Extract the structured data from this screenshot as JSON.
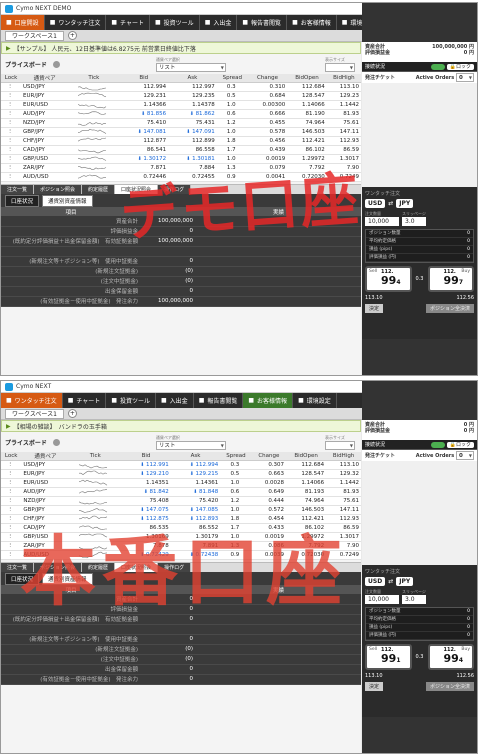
{
  "windows": [
    {
      "title": "Cymo NEXT DEMO",
      "menu": [
        {
          "label": "口座開設",
          "icon": "account-icon",
          "active": true
        },
        {
          "label": "ワンタッチ注文",
          "icon": "pointer-icon"
        },
        {
          "label": "チャート",
          "icon": "chart-icon"
        },
        {
          "label": "投資ツール",
          "icon": "tools-icon"
        },
        {
          "label": "入出金",
          "icon": "money-icon"
        },
        {
          "label": "報告書閲覧",
          "icon": "report-icon"
        },
        {
          "label": "お客様情報",
          "icon": "person-icon"
        },
        {
          "label": "環境設定",
          "icon": "settings-icon"
        }
      ],
      "help_label": "?",
      "logout_label": "ログアウト画面へ",
      "workspace_tab": "ワークスペース1",
      "news": "【サンプル】 人民元、12日基準値は6.8275元 前営業日終値比下落",
      "priceboard": {
        "title": "プライスボード",
        "select_label": "通貨ペア選択",
        "select_value": "リスト",
        "size_label": "表示サイズ"
      },
      "columns": [
        "Lock",
        "通貨ペア",
        "Tick",
        "Bid",
        "Ask",
        "Spread",
        "Change",
        "BidOpen",
        "BidHigh"
      ],
      "rows": [
        {
          "pair": "USD/JPY",
          "bid": "112.994",
          "ask": "112.997",
          "spread": "0.3",
          "change": "0.310",
          "open": "112.684",
          "high": "113.10"
        },
        {
          "pair": "EUR/JPY",
          "bid": "129.231",
          "ask": "129.235",
          "spread": "0.5",
          "change": "0.684",
          "open": "128.547",
          "high": "129.23"
        },
        {
          "pair": "EUR/USD",
          "bid": "1.14366",
          "ask": "1.14378",
          "spread": "1.0",
          "change": "0.00300",
          "open": "1.14066",
          "high": "1.1442"
        },
        {
          "pair": "AUD/JPY",
          "bid": "81.856",
          "ask": "81.862",
          "spread": "0.6",
          "change": "0.666",
          "open": "81.190",
          "high": "81.93"
        },
        {
          "pair": "NZD/JPY",
          "bid": "75.410",
          "ask": "75.431",
          "spread": "1.2",
          "change": "0.455",
          "open": "74.964",
          "high": "75.61"
        },
        {
          "pair": "GBP/JPY",
          "bid": "147.081",
          "ask": "147.091",
          "spread": "1.0",
          "change": "0.578",
          "open": "146.503",
          "high": "147.11"
        },
        {
          "pair": "CHF/JPY",
          "bid": "112.877",
          "ask": "112.899",
          "spread": "1.8",
          "change": "0.456",
          "open": "112.421",
          "high": "112.93"
        },
        {
          "pair": "CAD/JPY",
          "bid": "86.541",
          "ask": "86.558",
          "spread": "1.7",
          "change": "0.439",
          "open": "86.102",
          "high": "86.59"
        },
        {
          "pair": "GBP/USD",
          "bid": "1.30172",
          "ask": "1.30181",
          "spread": "1.0",
          "change": "0.0019",
          "open": "1.29972",
          "high": "1.3017"
        },
        {
          "pair": "ZAR/JPY",
          "bid": "7.871",
          "ask": "7.884",
          "spread": "1.3",
          "change": "0.079",
          "open": "7.792",
          "high": "7.90"
        },
        {
          "pair": "AUD/USD",
          "bid": "0.72446",
          "ask": "0.72455",
          "spread": "0.9",
          "change": "0.0041",
          "open": "0.72030",
          "high": "0.7249"
        }
      ],
      "tabs": [
        "注文一覧",
        "ポジション照会",
        "約定履歴",
        "口座状況照会",
        "操作ログ"
      ],
      "subtabs": [
        "口座状況",
        "通貨別資産情報"
      ],
      "acct_head": [
        "項目",
        "",
        "",
        "実績"
      ],
      "acct_rows": [
        {
          "label": "資産合計",
          "value": "100,000,000"
        },
        {
          "label": "評価損益金",
          "value": "0"
        },
        {
          "label": "(既約定分評価損益＋出金保留金額)　有効証拠金額",
          "value": "100,000,000"
        },
        {
          "label": "",
          "value": ""
        },
        {
          "label": "(新規注文等＋ポジション等)　使用中証拠金",
          "value": "0"
        },
        {
          "label": "(新規注文証拠金)",
          "value": "(0)"
        },
        {
          "label": "(注文中証拠金)",
          "value": "(0)"
        },
        {
          "label": "出金保留金額",
          "value": "0"
        },
        {
          "label": "(有効証拠金－使用中証拠金)　発注余力",
          "value": "100,000,000"
        }
      ],
      "right": {
        "asset_label": "資産合計",
        "asset_value": "100,000,000 円",
        "pl_label": "評価損益金",
        "pl_value": "0 円",
        "connection_label": "接続状況",
        "lock_label": "ロック",
        "order_label": "発注チケット",
        "active_orders": "Active Orders",
        "active_count": "0",
        "ticket_title": "ワンタッチ注文",
        "pair_base": "USD",
        "pair_quote": "JPY",
        "qty_label": "注文数量",
        "qty_value": "10,000",
        "slip_label": "スリッページ",
        "slip_value": "3.0",
        "pos_rows": [
          {
            "label": "ポジション数量",
            "value": "0"
          },
          {
            "label": "平均約定価格",
            "value": "0"
          },
          {
            "label": "損益 (pips)",
            "value": "0"
          },
          {
            "label": "評価損益 (円)",
            "value": "0"
          }
        ],
        "sell_label": "Sell",
        "buy_label": "Buy",
        "sell_pre": "112.",
        "sell_big": "99",
        "sell_small": "4",
        "buy_pre": "112.",
        "buy_big": "99",
        "buy_small": "7",
        "spread": "0.3",
        "low": "113.10",
        "high": "112.56",
        "btn1": "決定",
        "btn2": "ポジション全決済"
      },
      "overlay": "デモ口座"
    },
    {
      "title": "Cymo NEXT",
      "menu": [
        {
          "label": "ワンタッチ注文",
          "icon": "pointer-icon",
          "active": true
        },
        {
          "label": "チャート",
          "icon": "chart-icon"
        },
        {
          "label": "投資ツール",
          "icon": "tools-icon"
        },
        {
          "label": "入出金",
          "icon": "money-icon"
        },
        {
          "label": "報告書閲覧",
          "icon": "report-icon"
        },
        {
          "label": "お客様情報",
          "icon": "person-icon",
          "green": true
        },
        {
          "label": "環境設定",
          "icon": "settings-icon"
        }
      ],
      "help_label": "?",
      "logout_label": "ログアウト画面へ",
      "workspace_tab": "ワークスペース1",
      "news": "【相場の雑談】　バンドラの玉手箱",
      "priceboard": {
        "title": "プライスボード",
        "select_label": "通貨ペア選択",
        "select_value": "リスト",
        "size_label": "表示サイズ"
      },
      "columns": [
        "Lock",
        "通貨ペア",
        "Tick",
        "Bid",
        "Ask",
        "Spread",
        "Change",
        "BidOpen",
        "BidHigh"
      ],
      "rows": [
        {
          "pair": "USD/JPY",
          "bid": "112.991",
          "ask": "112.994",
          "spread": "0.3",
          "change": "0.307",
          "open": "112.684",
          "high": "113.10"
        },
        {
          "pair": "EUR/JPY",
          "bid": "129.210",
          "ask": "129.215",
          "spread": "0.5",
          "change": "0.663",
          "open": "128.547",
          "high": "129.32"
        },
        {
          "pair": "EUR/USD",
          "bid": "1.14351",
          "ask": "1.14361",
          "spread": "1.0",
          "change": "0.0028",
          "open": "1.14066",
          "high": "1.1442"
        },
        {
          "pair": "AUD/JPY",
          "bid": "81.842",
          "ask": "81.848",
          "spread": "0.6",
          "change": "0.649",
          "open": "81.193",
          "high": "81.93"
        },
        {
          "pair": "NZD/JPY",
          "bid": "75.408",
          "ask": "75.420",
          "spread": "1.2",
          "change": "0.444",
          "open": "74.964",
          "high": "75.61"
        },
        {
          "pair": "GBP/JPY",
          "bid": "147.075",
          "ask": "147.085",
          "spread": "1.0",
          "change": "0.572",
          "open": "146.503",
          "high": "147.11"
        },
        {
          "pair": "CHF/JPY",
          "bid": "112.875",
          "ask": "112.893",
          "spread": "1.8",
          "change": "0.454",
          "open": "112.421",
          "high": "112.93"
        },
        {
          "pair": "CAD/JPY",
          "bid": "86.535",
          "ask": "86.552",
          "spread": "1.7",
          "change": "0.433",
          "open": "86.102",
          "high": "86.59"
        },
        {
          "pair": "GBP/USD",
          "bid": "1.30169",
          "ask": "1.30179",
          "spread": "1.0",
          "change": "0.0019",
          "open": "1.29972",
          "high": "1.3017"
        },
        {
          "pair": "ZAR/JPY",
          "bid": "7.878",
          "ask": "7.891",
          "spread": "1.3",
          "change": "0.086",
          "open": "7.792",
          "high": "7.90"
        },
        {
          "pair": "AUD/USD",
          "bid": "0.72429",
          "ask": "0.72438",
          "spread": "0.9",
          "change": "0.0039",
          "open": "0.72030",
          "high": "0.7249"
        }
      ],
      "tabs": [
        "注文一覧",
        "ポジション照会",
        "約定履歴",
        "口座状況照会",
        "操作ログ"
      ],
      "subtabs": [
        "口座状況",
        "通貨別資産情報"
      ],
      "acct_head": [
        "項目",
        "",
        "",
        "実績"
      ],
      "acct_rows": [
        {
          "label": "資産合計",
          "value": "0"
        },
        {
          "label": "評価損益金",
          "value": "0"
        },
        {
          "label": "(既約定分評価損益＋出金保留金額)　有効証拠金額",
          "value": "0"
        },
        {
          "label": "",
          "value": ""
        },
        {
          "label": "(新規注文等＋ポジション等)　使用中証拠金",
          "value": "0"
        },
        {
          "label": "(新規注文証拠金)",
          "value": "(0)"
        },
        {
          "label": "(注文中証拠金)",
          "value": "(0)"
        },
        {
          "label": "出金保留金額",
          "value": "0"
        },
        {
          "label": "(有効証拠金－使用中証拠金)　発注余力",
          "value": "0"
        }
      ],
      "right": {
        "asset_label": "資産合計",
        "asset_value": "0 円",
        "pl_label": "評価損益金",
        "pl_value": "0 円",
        "connection_label": "接続状況",
        "lock_label": "ロック",
        "order_label": "発注チケット",
        "active_orders": "Active Orders",
        "active_count": "0",
        "ticket_title": "ワンタッチ注文",
        "pair_base": "USD",
        "pair_quote": "JPY",
        "qty_label": "注文数量",
        "qty_value": "10,000",
        "slip_label": "スリッページ",
        "slip_value": "3.0",
        "pos_rows": [
          {
            "label": "ポジション数量",
            "value": "0"
          },
          {
            "label": "平均約定価格",
            "value": "0"
          },
          {
            "label": "損益 (pips)",
            "value": "0"
          },
          {
            "label": "評価損益 (円)",
            "value": "0"
          }
        ],
        "sell_label": "Sell",
        "buy_label": "Buy",
        "sell_pre": "112.",
        "sell_big": "99",
        "sell_small": "1",
        "buy_pre": "112.",
        "buy_big": "99",
        "buy_small": "4",
        "spread": "0.3",
        "low": "113.10",
        "high": "112.56",
        "btn1": "決定",
        "btn2": "ポジション全決済"
      },
      "overlay": "本番口座"
    }
  ],
  "colors": {
    "menu_bg": "#2b2b2b",
    "active_menu": "#d65a13",
    "bid_blue": "#1565d8",
    "overlay_red": "#e62828"
  }
}
